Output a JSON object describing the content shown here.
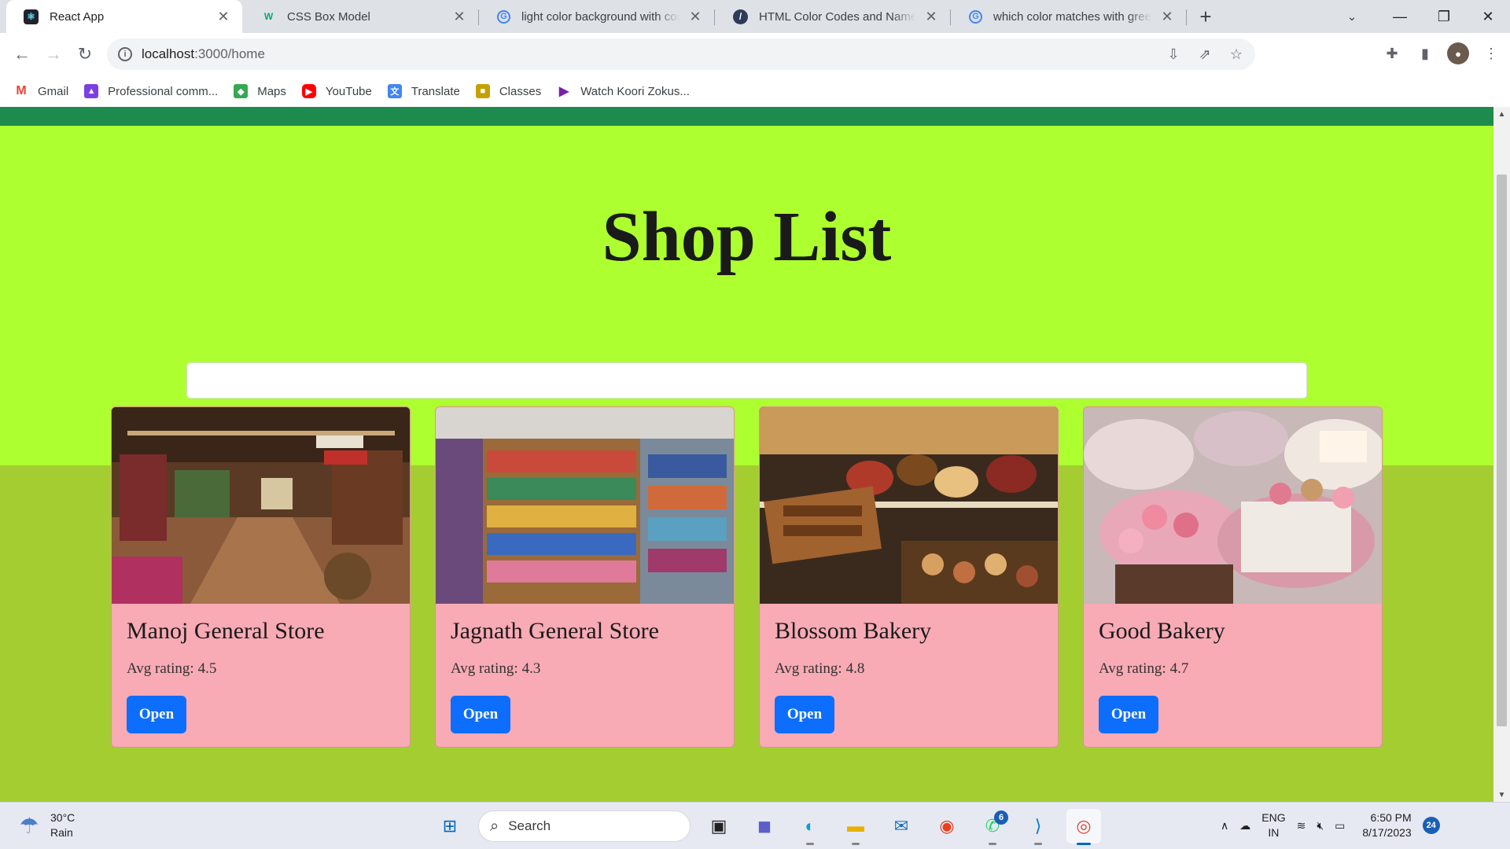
{
  "browser": {
    "tabs": [
      {
        "title": "React App",
        "icon": "react-icon",
        "active": true
      },
      {
        "title": "CSS Box Model",
        "icon": "w3schools-icon",
        "active": false
      },
      {
        "title": "light color background with code",
        "icon": "google-icon",
        "active": false
      },
      {
        "title": "HTML Color Codes and Names",
        "icon": "colorcodes-icon",
        "active": false
      },
      {
        "title": "which color matches with green -",
        "icon": "google-icon",
        "active": false
      }
    ],
    "url_host": "localhost",
    "url_path": ":3000/home",
    "bookmarks": [
      {
        "label": "Gmail",
        "icon": "gmail-icon",
        "color": "#ea4335"
      },
      {
        "label": "Professional comm...",
        "icon": "classroom-icon",
        "color": "#7b3fe4"
      },
      {
        "label": "Maps",
        "icon": "maps-icon",
        "color": "#34a853"
      },
      {
        "label": "YouTube",
        "icon": "youtube-icon",
        "color": "#ff0000"
      },
      {
        "label": "Translate",
        "icon": "translate-icon",
        "color": "#4285f4"
      },
      {
        "label": "Classes",
        "icon": "classes-icon",
        "color": "#c5a100"
      },
      {
        "label": "Watch Koori Zokus...",
        "icon": "play-icon",
        "color": "#7b1fa2"
      }
    ]
  },
  "page": {
    "title": "Shop List",
    "search": {
      "value": "",
      "placeholder": ""
    },
    "colors": {
      "top_bar": "#1d8a4e",
      "hero_bg": "#adff2f",
      "content_bg": "#a4cd32",
      "card_bg": "#f8aab5",
      "button": "#0d6efd"
    },
    "shops": [
      {
        "name": "Manoj General Store",
        "rating_label": "Avg rating:",
        "rating": "4.5",
        "button": "Open",
        "image": "general-store-interior-image"
      },
      {
        "name": "Jagnath General Store",
        "rating_label": "Avg rating:",
        "rating": "4.3",
        "button": "Open",
        "image": "grocery-shelves-image"
      },
      {
        "name": "Blossom Bakery",
        "rating_label": "Avg rating:",
        "rating": "4.8",
        "button": "Open",
        "image": "bakery-display-image"
      },
      {
        "name": "Good Bakery",
        "rating_label": "Avg rating:",
        "rating": "4.7",
        "button": "Open",
        "image": "cakes-macarons-image"
      }
    ]
  },
  "taskbar": {
    "weather_temp": "30°C",
    "weather_desc": "Rain",
    "search_label": "Search",
    "whatsapp_badge": "6",
    "lang_top": "ENG",
    "lang_bottom": "IN",
    "time": "6:50 PM",
    "date": "8/17/2023",
    "notification_count": "24"
  }
}
